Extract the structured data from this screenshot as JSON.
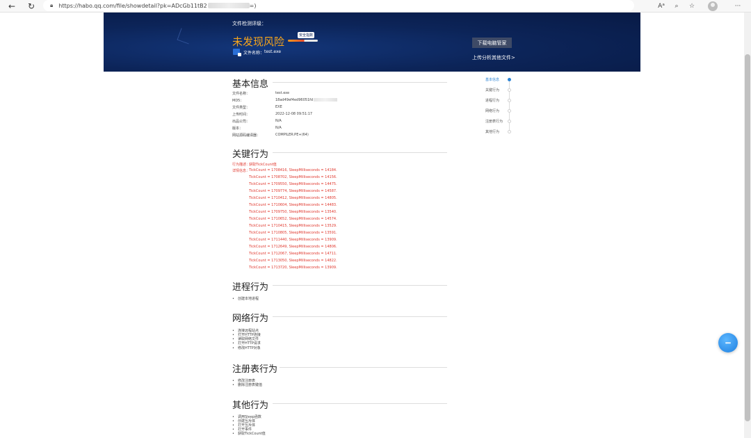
{
  "browser": {
    "url": "https://habo.qq.com/file/showdetail?pk=ADcGb11tB2",
    "url_suffix": "=)",
    "icons": [
      "back-icon",
      "refresh-icon",
      "lock-icon",
      "read-aloud-icon",
      "zoom-icon",
      "favorites-icon",
      "profile-icon",
      "more-icon"
    ]
  },
  "banner": {
    "label": "文件检测评级：",
    "result": "未发现风险",
    "badge": "安全指数",
    "file_label": "文件名称：",
    "file_name": "test.exe",
    "download_button": "下载电脑管家",
    "upload_link": "上传分析其他文件>"
  },
  "basic_info": {
    "title": "基本信息",
    "rows": [
      {
        "k": "文件名称：",
        "v": "test.exe"
      },
      {
        "k": "MD5：",
        "v": "18ad49ef4ed96051fd"
      },
      {
        "k": "文件类型：",
        "v": "EXE"
      },
      {
        "k": "上传时间：",
        "v": "2022-12-08 09:51:17"
      },
      {
        "k": "出品公司：",
        "v": "N/A"
      },
      {
        "k": "版本：",
        "v": "N/A"
      },
      {
        "k": "网站源码编译器：",
        "v": "COMPILER:PE+(64)"
      }
    ]
  },
  "key_behavior": {
    "title": "关键行为",
    "desc_label": "行为描述：",
    "desc_value": "获取TickCount值",
    "detail_label": "详情信息：",
    "lines": [
      "TickCount = 1708416, SleepMilliseconds = 14184.",
      "TickCount = 1708702, SleepMilliseconds = 14156.",
      "TickCount = 1709550, SleepMilliseconds = 14475.",
      "TickCount = 1709774, SleepMilliseconds = 14587.",
      "TickCount = 1710412, SleepMilliseconds = 14805.",
      "TickCount = 1710604, SleepMilliseconds = 14483.",
      "TickCount = 1709750, SleepMilliseconds = 13540.",
      "TickCount = 1710652, SleepMilliseconds = 14574.",
      "TickCount = 1710415, SleepMilliseconds = 13529.",
      "TickCount = 1710805, SleepMilliseconds = 13591.",
      "TickCount = 1711440, SleepMilliseconds = 13909.",
      "TickCount = 1712649, SleepMilliseconds = 14806.",
      "TickCount = 1712067, SleepMilliseconds = 14711.",
      "TickCount = 1713050, SleepMilliseconds = 14822.",
      "TickCount = 1713720, SleepMilliseconds = 13909."
    ]
  },
  "process": {
    "title": "进程行为",
    "items": [
      "创建本地进程"
    ]
  },
  "network": {
    "title": "网络行为",
    "items": [
      "连接远程站点",
      "打开HTTP连接",
      "读取网络文件",
      "打开HTTP请求",
      "修改HTTP对象"
    ]
  },
  "registry": {
    "title": "注册表行为",
    "items": [
      "修改注册表",
      "删除注册表键值"
    ]
  },
  "other": {
    "title": "其他行为",
    "items": [
      "调用Sleep函数",
      "创建互斥体",
      "打开互斥体",
      "打开事件",
      "获取TickCount值"
    ]
  },
  "side_nav": [
    {
      "label": "基本信息",
      "active": true
    },
    {
      "label": "关键行为",
      "active": false
    },
    {
      "label": "进程行为",
      "active": false
    },
    {
      "label": "网络行为",
      "active": false
    },
    {
      "label": "注册表行为",
      "active": false
    },
    {
      "label": "其他行为",
      "active": false
    }
  ],
  "colors": {
    "banner": "#0c2458",
    "accent_orange": "#f7a51c",
    "danger_red": "#e0382e",
    "nav_active": "#2b84d6"
  }
}
